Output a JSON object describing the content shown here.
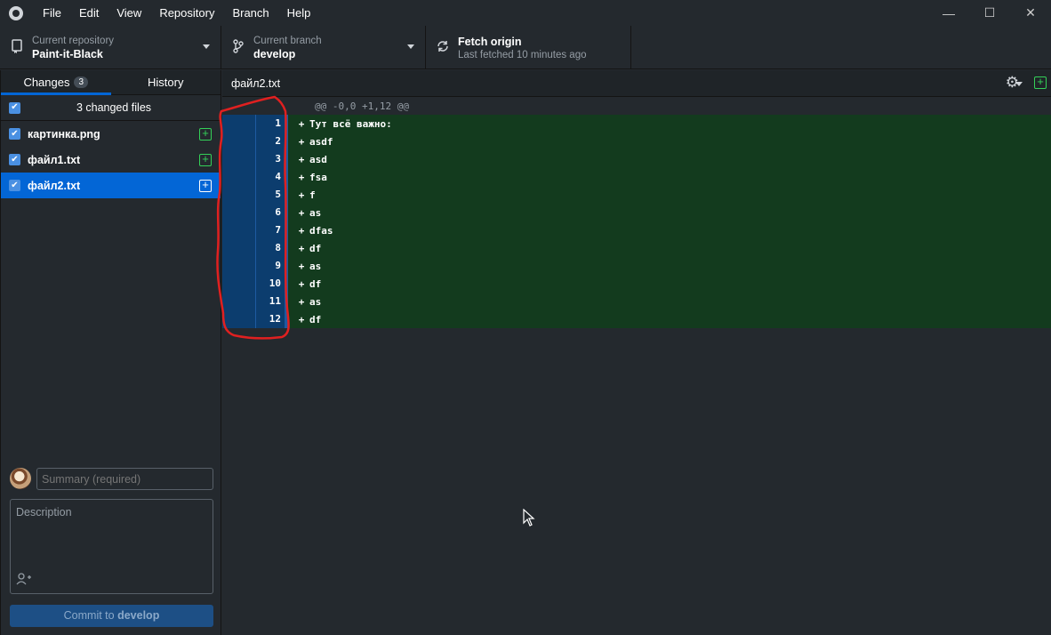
{
  "menu": {
    "items": [
      "File",
      "Edit",
      "View",
      "Repository",
      "Branch",
      "Help"
    ]
  },
  "toolbar": {
    "repo_label": "Current repository",
    "repo_value": "Paint-it-Black",
    "branch_label": "Current branch",
    "branch_value": "develop",
    "fetch_label": "Fetch origin",
    "fetch_sub": "Last fetched 10 minutes ago"
  },
  "sidebar": {
    "tabs": [
      {
        "label": "Changes",
        "badge": "3"
      },
      {
        "label": "History"
      }
    ],
    "header": "3 changed files",
    "files": [
      {
        "name": "картинка.png"
      },
      {
        "name": "файл1.txt"
      },
      {
        "name": "файл2.txt"
      }
    ]
  },
  "commit": {
    "summary_placeholder": "Summary (required)",
    "description_placeholder": "Description",
    "button_prefix": "Commit to ",
    "button_branch": "develop"
  },
  "diff": {
    "filename": "файл2.txt",
    "hunk": "@@ -0,0 +1,12 @@",
    "lines": [
      {
        "num": "1",
        "sign": "+",
        "text": "Тут всё важно:"
      },
      {
        "num": "2",
        "sign": "+",
        "text": "asdf"
      },
      {
        "num": "3",
        "sign": "+",
        "text": "asd"
      },
      {
        "num": "4",
        "sign": "+",
        "text": "fsa"
      },
      {
        "num": "5",
        "sign": "+",
        "text": "f"
      },
      {
        "num": "6",
        "sign": "+",
        "text": "as"
      },
      {
        "num": "7",
        "sign": "+",
        "text": "dfas"
      },
      {
        "num": "8",
        "sign": "+",
        "text": "df"
      },
      {
        "num": "9",
        "sign": "+",
        "text": "as"
      },
      {
        "num": "10",
        "sign": "+",
        "text": "df"
      },
      {
        "num": "11",
        "sign": "+",
        "text": "as"
      },
      {
        "num": "12",
        "sign": "+",
        "text": "df"
      }
    ]
  },
  "colors": {
    "accent": "#0366d6",
    "added_bg": "#133b1e",
    "annotation": "#e02020"
  }
}
